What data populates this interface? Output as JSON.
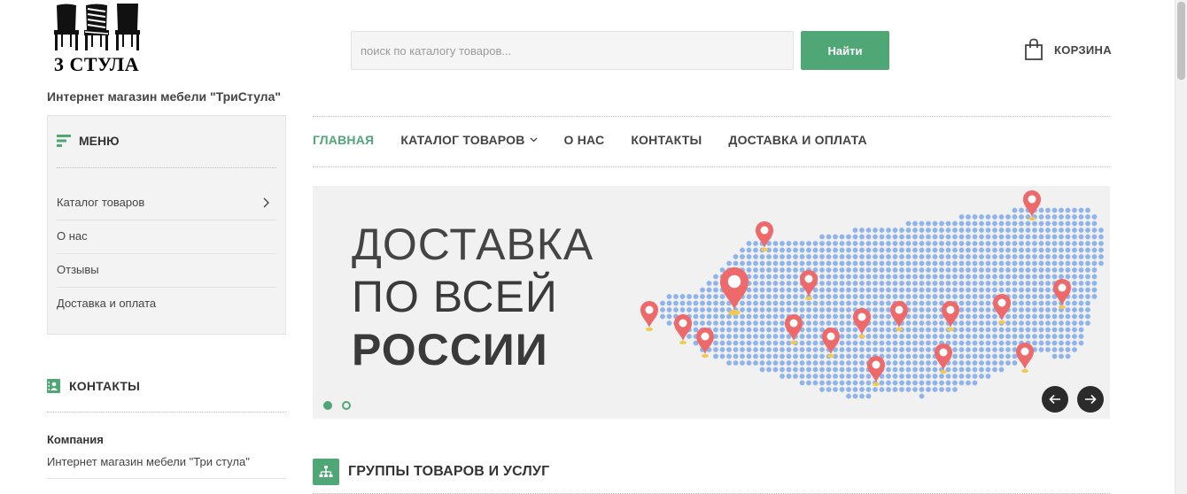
{
  "header": {
    "logo_text": "3 СТУЛА",
    "tagline": "Интернет магазин мебели \"ТриСтула\"",
    "search_placeholder": "поиск по каталогу товаров...",
    "search_button": "Найти",
    "cart_label": "КОРЗИНА"
  },
  "sidebar": {
    "menu_title": "МЕНЮ",
    "items": [
      {
        "label": "Каталог товаров",
        "has_submenu": true
      },
      {
        "label": "О нас"
      },
      {
        "label": "Отзывы"
      },
      {
        "label": "Доставка и оплата"
      }
    ],
    "contacts_title": "КОНТАКТЫ",
    "company_label": "Компания",
    "company_value": "Интернет магазин мебели \"Три стула\""
  },
  "nav": {
    "items": [
      {
        "label": "ГЛАВНАЯ",
        "active": true
      },
      {
        "label": "КАТАЛОГ ТОВАРОВ",
        "dropdown": true
      },
      {
        "label": "О НАС"
      },
      {
        "label": "КОНТАКТЫ"
      },
      {
        "label": "ДОСТАВКА И ОПЛАТА"
      }
    ]
  },
  "banner": {
    "line1": "ДОСТАВКА",
    "line2": "ПО ВСЕЙ",
    "line3": "РОССИИ",
    "slides": 2,
    "active_slide": 1
  },
  "groups": {
    "title": "ГРУППЫ ТОВАРОВ И УСЛУГ"
  },
  "colors": {
    "accent": "#50a776",
    "map_dots": "#8fb3ec",
    "pins": "#ee6a6a"
  }
}
